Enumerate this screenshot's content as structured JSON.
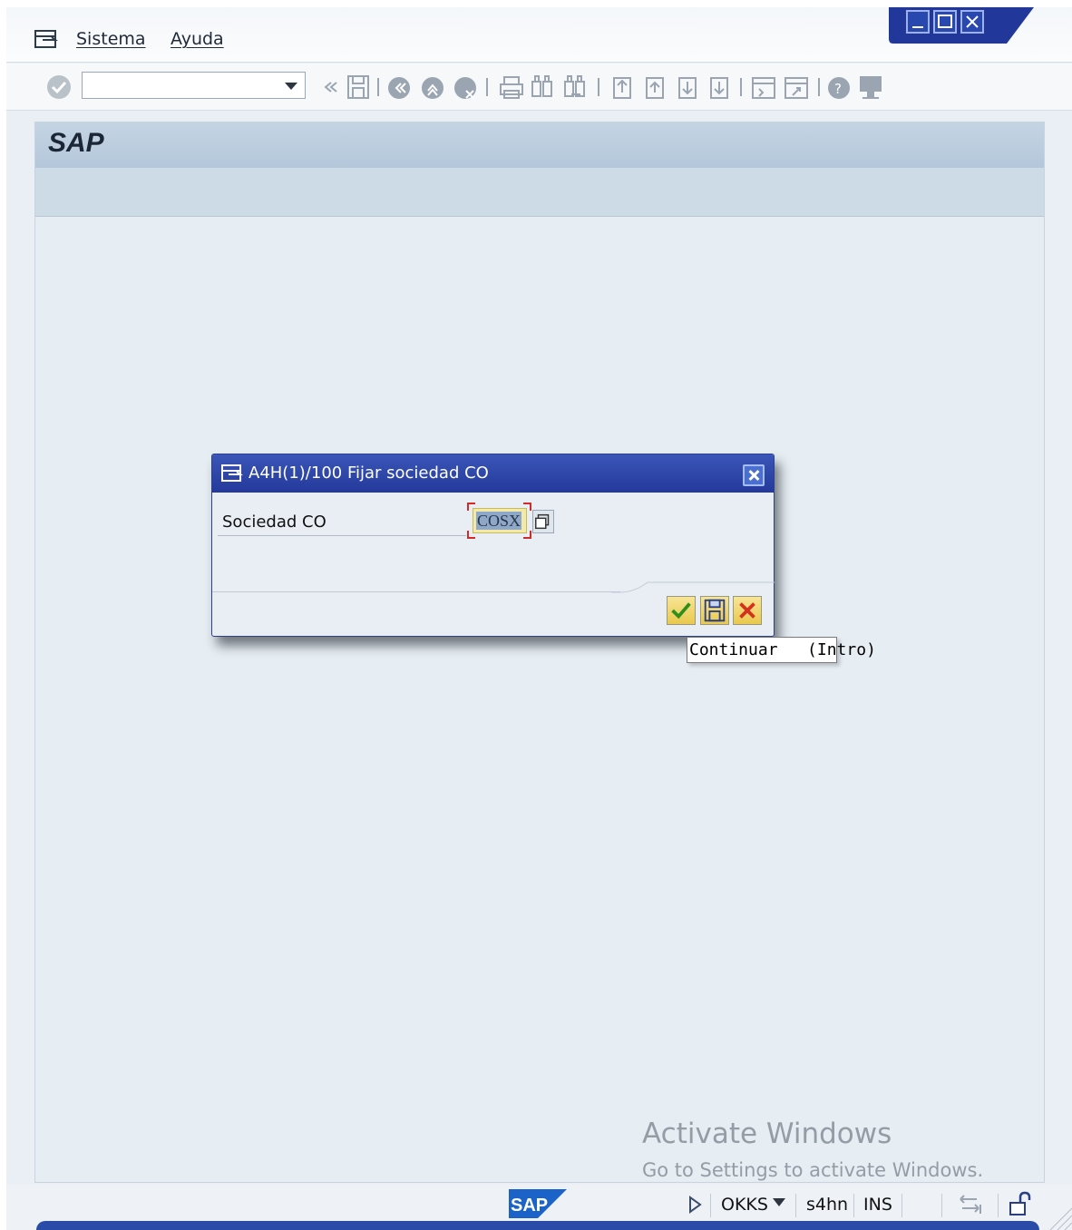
{
  "menubar": {
    "items": [
      "Sistema",
      "Ayuda"
    ]
  },
  "toolbar": {
    "command_field_value": "",
    "icons": [
      "check-icon",
      "back-icon",
      "save-icon",
      "back-nav-icon",
      "exit-icon",
      "cancel-icon",
      "print-icon",
      "find-icon",
      "find-next-icon",
      "first-page-icon",
      "previous-page-icon",
      "next-page-icon",
      "last-page-icon",
      "new-session-icon",
      "shortcut-icon",
      "help-icon",
      "customize-layout-icon"
    ]
  },
  "header": {
    "title": "SAP"
  },
  "dialog": {
    "title": "A4H(1)/100 Fijar sociedad CO",
    "field_label": "Sociedad CO",
    "field_value": "COSX",
    "buttons": [
      "continue-button",
      "save-button",
      "cancel-button"
    ]
  },
  "tooltip": {
    "text": "Continuar   (Intro)"
  },
  "watermark": {
    "title": "Activate Windows",
    "subtitle": "Go to Settings to activate Windows."
  },
  "statusbar": {
    "transaction": "OKKS",
    "server": "s4hn",
    "mode": "INS"
  },
  "colors": {
    "dialog_title_bar": "#24399b",
    "input_highlight": "#f3e9a9",
    "selection": "#8fa8c8"
  }
}
